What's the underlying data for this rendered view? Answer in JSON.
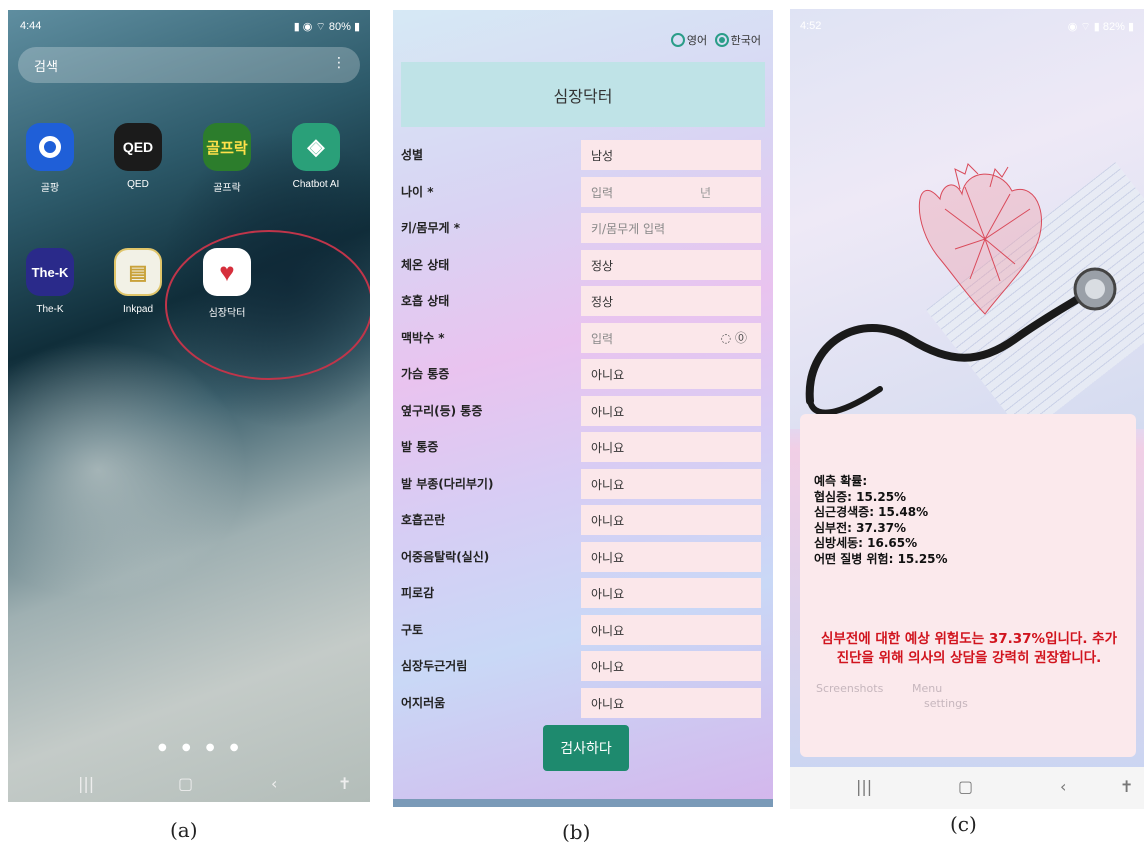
{
  "panel_a": {
    "status": {
      "time": "4:44",
      "right": "80%"
    },
    "search_placeholder": "검색",
    "apps": [
      {
        "label": "골팡",
        "icon_text": "golfpong"
      },
      {
        "label": "QED",
        "icon_text": "QED"
      },
      {
        "label": "골프락",
        "icon_text": "골프락"
      },
      {
        "label": "Chatbot AI",
        "icon_text": "◈"
      },
      {
        "label": "The-K",
        "icon_text": "The-K"
      },
      {
        "label": "Inkpad",
        "icon_text": "▤"
      },
      {
        "label": "심장닥터",
        "icon_text": "♥"
      }
    ],
    "caption": "(a)"
  },
  "panel_b": {
    "lang_options": [
      "영어",
      "한국어"
    ],
    "title": "심장닥터",
    "rows": [
      {
        "label": "성별",
        "value": "남성"
      },
      {
        "label": "나이 *",
        "value": "입력",
        "unit": "년"
      },
      {
        "label": "키/몸무게 *",
        "value": "키/몸무게 입력"
      },
      {
        "label": "체온 상태",
        "value": "정상"
      },
      {
        "label": "호흡 상태",
        "value": "정상"
      },
      {
        "label": "맥박수 *",
        "value": "입력"
      },
      {
        "label": "가슴 통증",
        "value": "아니요"
      },
      {
        "label": "옆구리(등) 통증",
        "value": "아니요"
      },
      {
        "label": "발 통증",
        "value": "아니요"
      },
      {
        "label": "발 부종(다리부기)",
        "value": "아니요"
      },
      {
        "label": "호흡곤란",
        "value": "아니요"
      },
      {
        "label": "어중음탈락(실신)",
        "value": "아니요"
      },
      {
        "label": "피로감",
        "value": "아니요"
      },
      {
        "label": "구토",
        "value": "아니요"
      },
      {
        "label": "심장두근거림",
        "value": "아니요"
      },
      {
        "label": "어지러움",
        "value": "아니요"
      }
    ],
    "submit": "검사하다",
    "caption": "(b)"
  },
  "panel_c": {
    "status": {
      "time": "4:52",
      "right": "82%"
    },
    "result_lines": [
      "예측 확률:",
      "협심증: 15.25%",
      "심근경색증: 15.48%",
      "심부전: 37.37%",
      "심방세동: 16.65%",
      "어떤 질병 위험: 15.25%"
    ],
    "ghost_labels": [
      "Screenshots",
      "Menu",
      "settings"
    ],
    "advice": "심부전에 대한 예상 위험도는 37.37%입니다. 추가 진단을 위해 의사의 상담을 강력히 권장합니다.",
    "caption": "(c)"
  },
  "colors": {
    "accent_green": "#1e8a6e",
    "title_bar": "#bfe3e7",
    "field_bg": "#fbe7ea",
    "advice_red": "#d1141e",
    "circle_red": "#c0354a"
  }
}
